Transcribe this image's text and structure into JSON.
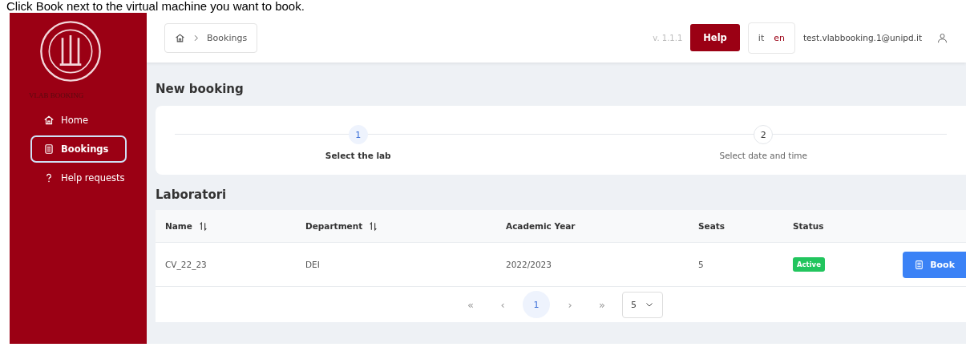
{
  "caption": "Click Book next to the virtual machine you want to book.",
  "sidebar": {
    "app_name": "VLAB BOOKING",
    "items": [
      {
        "label": "Home",
        "kind": "home",
        "selected": false
      },
      {
        "label": "Bookings",
        "kind": "book",
        "selected": true
      },
      {
        "label": "Help requests",
        "kind": "help",
        "selected": false
      }
    ]
  },
  "header": {
    "breadcrumb": "Bookings",
    "version": "v. 1.1.1",
    "help_button": "Help",
    "languages": [
      {
        "code": "it",
        "selected": false
      },
      {
        "code": "en",
        "selected": true
      }
    ],
    "user": "test.vlabbooking.1@unipd.it"
  },
  "page_title": "New booking",
  "steps": [
    {
      "number": "1",
      "label": "Select the lab",
      "selected": true
    },
    {
      "number": "2",
      "label": "Select date and time",
      "selected": false
    }
  ],
  "section_title": "Laboratori",
  "table": {
    "columns": [
      {
        "label": "Name",
        "sortable": true
      },
      {
        "label": "Department",
        "sortable": true
      },
      {
        "label": "Academic Year",
        "sortable": false
      },
      {
        "label": "Seats",
        "sortable": false
      },
      {
        "label": "Status",
        "sortable": false
      }
    ],
    "rows": [
      {
        "cells": [
          "CV_22_23",
          "DEI",
          "2022/2023",
          "5"
        ],
        "status": "Active",
        "action": "Book"
      }
    ]
  },
  "pagination": {
    "first": "«",
    "prev": "‹",
    "pages": [
      {
        "label": "1",
        "selected": true
      }
    ],
    "next": "›",
    "last": "»",
    "page_size": "5"
  }
}
